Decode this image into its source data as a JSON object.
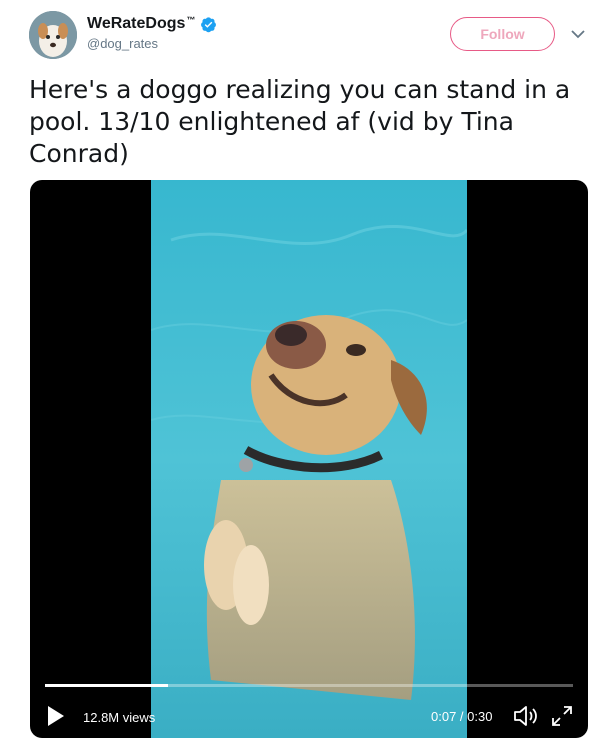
{
  "user": {
    "display_name": "WeRateDogs",
    "trademark": "™",
    "handle": "@dog_rates",
    "verified": true
  },
  "follow_button": {
    "label": "Follow"
  },
  "tweet": {
    "text": "Here's a doggo realizing you can stand in a pool. 13/10 enlightened af (vid by Tina Conrad)"
  },
  "video": {
    "views": "12.8M views",
    "current_time": "0:07",
    "separator": " / ",
    "duration": "0:30",
    "progress_fraction": 0.233
  },
  "icons": {
    "verified": "verified-badge-icon",
    "caret": "chevron-down-icon",
    "play": "play-icon",
    "volume": "volume-icon",
    "fullscreen": "fullscreen-icon"
  },
  "colors": {
    "follow_accent": "#e0245e",
    "verified_blue": "#1da1f2",
    "pool_water": "#4fc3d6"
  }
}
